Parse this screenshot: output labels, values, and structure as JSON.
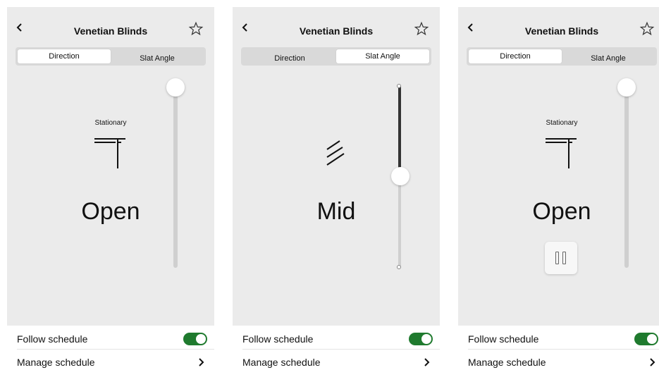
{
  "colors": {
    "panel": "#ebebeb",
    "accent_toggle": "#1f7a2e"
  },
  "screens": [
    {
      "title": "Venetian Blinds",
      "tabs": [
        "Direction",
        "Slat Angle"
      ],
      "active_tab": "Direction",
      "status": "Stationary",
      "state": "Open",
      "slider_level": 1.0,
      "follow_schedule_label": "Follow schedule",
      "follow_schedule_on": true,
      "manage_schedule_label": "Manage schedule"
    },
    {
      "title": "Venetian Blinds",
      "tabs": [
        "Direction",
        "Slat Angle"
      ],
      "active_tab": "Slat Angle",
      "state": "Mid",
      "slider_level": 0.5,
      "follow_schedule_label": "Follow schedule",
      "follow_schedule_on": true,
      "manage_schedule_label": "Manage schedule"
    },
    {
      "title": "Venetian Blinds",
      "tabs": [
        "Direction",
        "Slat Angle"
      ],
      "active_tab": "Direction",
      "status": "Stationary",
      "state": "Open",
      "slider_level": 1.0,
      "pause_icon": "pause-icon",
      "follow_schedule_label": "Follow schedule",
      "follow_schedule_on": true,
      "manage_schedule_label": "Manage schedule"
    }
  ]
}
